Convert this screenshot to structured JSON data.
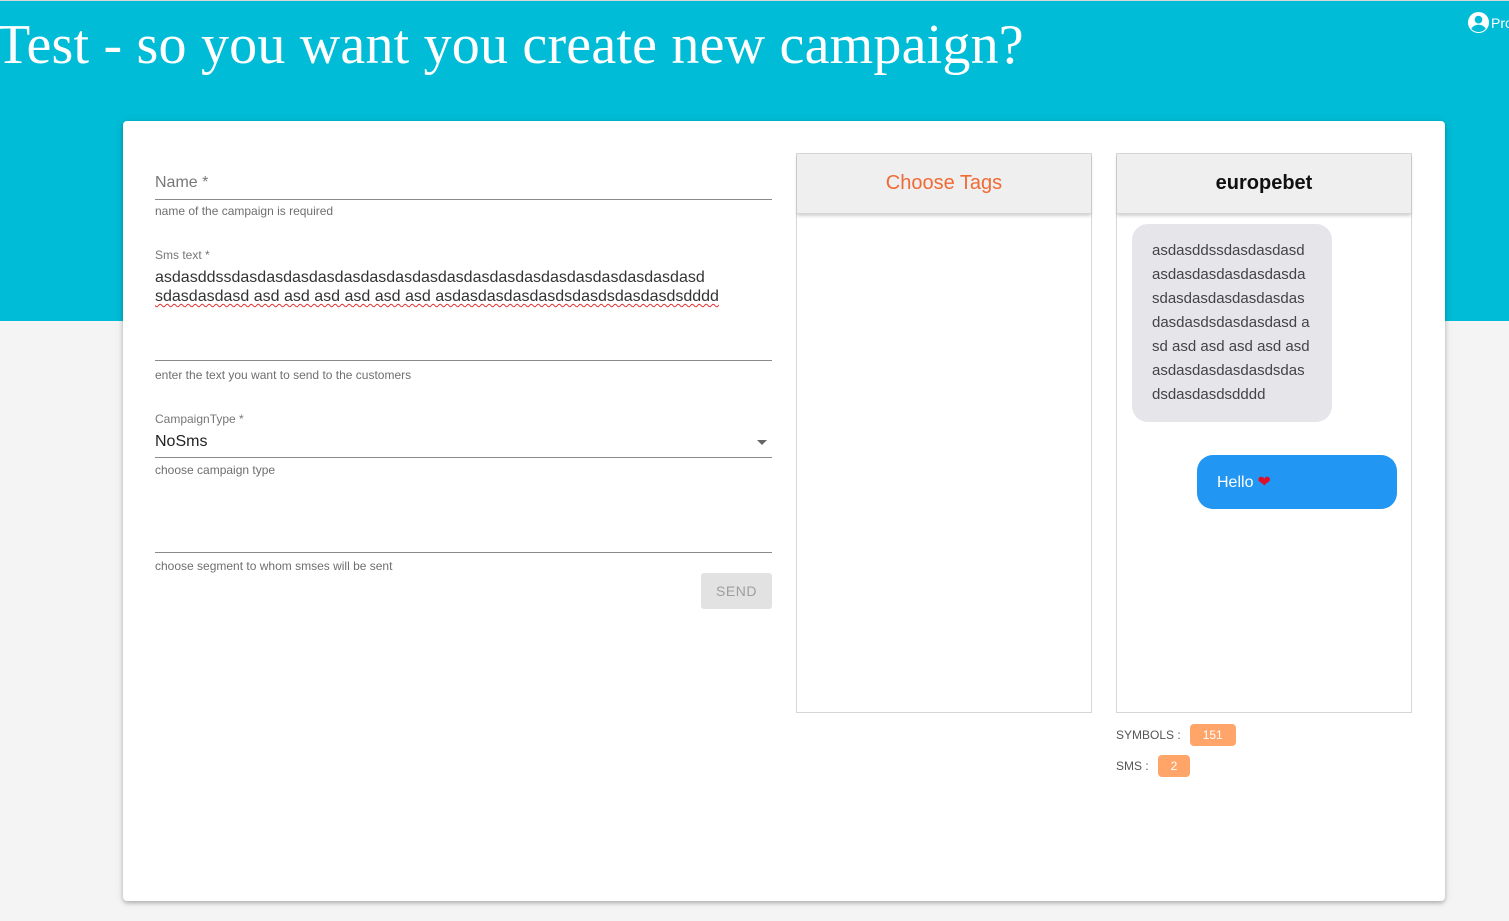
{
  "header": {
    "title": "Test - so you want you create new campaign?",
    "profile_label": "Profile"
  },
  "form": {
    "name_placeholder": "Name *",
    "name_helper": "name of the campaign is required",
    "sms_label": "Sms text *",
    "sms_line1": "asdasddssdasdasdasdasdasdasdasdasdasdasdasdasdasdasdasdasdasdasd",
    "sms_line2": "sdasdasdasd asd asd asd asd asd asd asdasdasdasdasdsdasdsdasdasdsdddd",
    "sms_helper": "enter the text you want to send to the customers",
    "campaign_type_label": "CampaignType *",
    "campaign_type_value": "NoSms",
    "campaign_type_helper": "choose campaign type",
    "segment_helper": "choose segment to whom smses will be sent",
    "send_label": "SEND"
  },
  "tags": {
    "title": "Choose Tags"
  },
  "preview": {
    "title": "europebet",
    "incoming_message": "asdasddssdasdasdasdasdasdasdasdasdasdasdasdasdasdasdasdasdasdasdsdasdasdasd asd asd asd asd asd asd asdasdasdasdasdsdasdsdasdasdsdddd",
    "outgoing_message": "Hello",
    "outgoing_emoji": "❤"
  },
  "stats": {
    "symbols_label": "SYMBOLS :",
    "symbols_value": "151",
    "sms_label": "SMS :",
    "sms_value": "2"
  },
  "colors": {
    "header_bg": "#00bcd6",
    "tags_title": "#f06a35",
    "badge": "#ffa569",
    "outgoing_bubble": "#2196f3",
    "incoming_bubble": "#e5e5ea"
  },
  "icons": {
    "profile": "account-circle-icon",
    "dropdown": "caret-down-icon"
  }
}
